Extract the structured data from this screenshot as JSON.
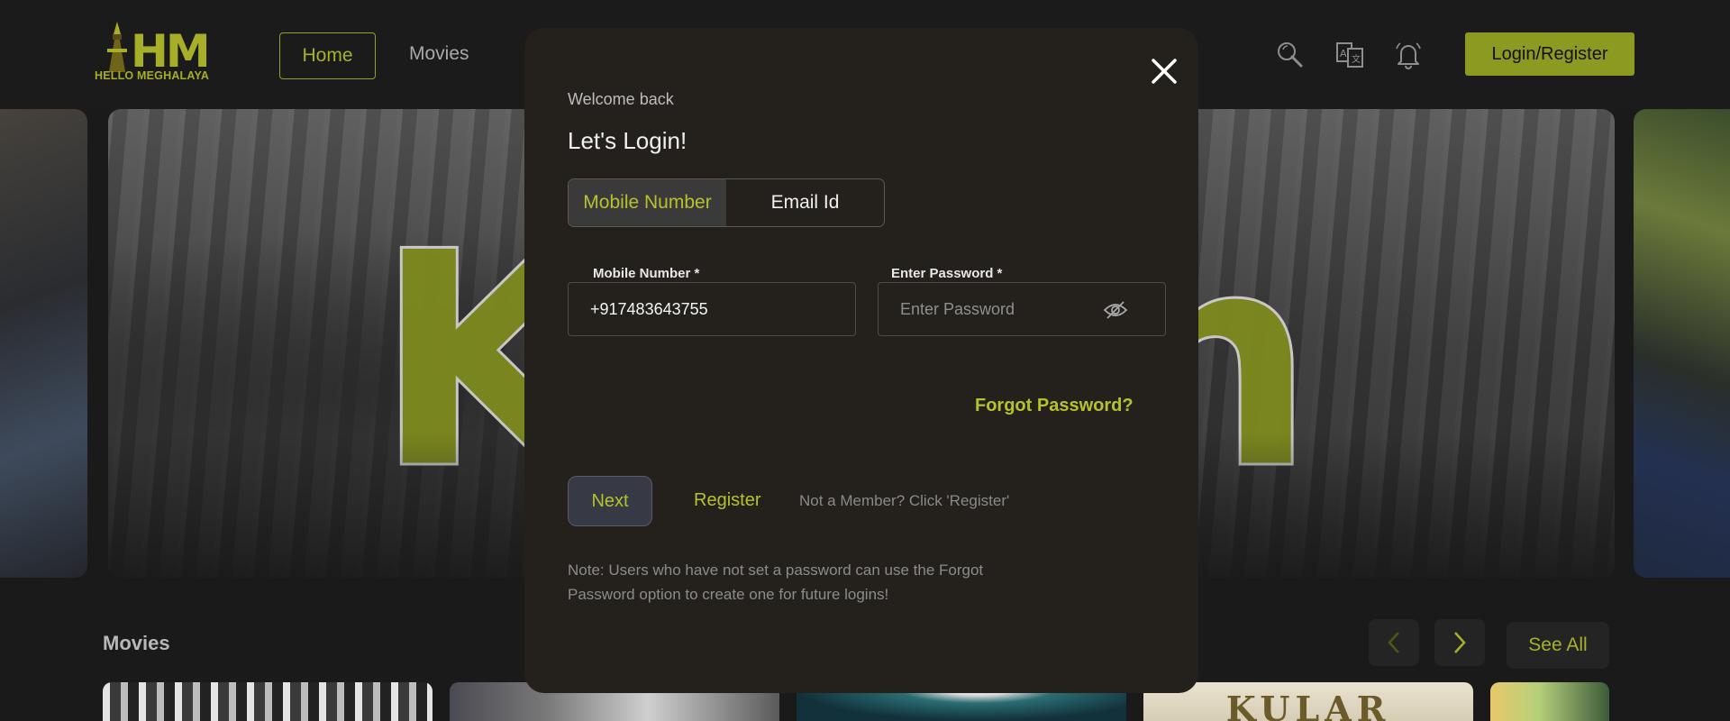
{
  "header": {
    "logo_text": "HELLO MEGHALAYA",
    "logo_mark": "HM",
    "nav": {
      "home": "Home",
      "movies": "Movies"
    },
    "icons": [
      "search-icon",
      "translate-icon",
      "bell-icon"
    ],
    "login_label": "Login/Register",
    "accent": "#8c9a22"
  },
  "hero": {
    "letters": [
      "K",
      "h"
    ]
  },
  "movies": {
    "title": "Movies",
    "see_all": "See All",
    "thumbs": [
      {
        "label": ""
      },
      {
        "label": ""
      },
      {
        "label": ""
      },
      {
        "label": "KULAR"
      },
      {
        "label": ""
      }
    ]
  },
  "modal": {
    "welcome": "Welcome back",
    "title": "Let's Login!",
    "tabs": {
      "mobile": "Mobile Number",
      "email": "Email Id"
    },
    "mobile_label": "Mobile Number *",
    "mobile_value": "+917483643755",
    "password_label": "Enter Password *",
    "password_placeholder": "Enter Password",
    "forgot": "Forgot Password?",
    "next": "Next",
    "register": "Register",
    "not_member": "Not a Member? Click 'Register'",
    "note": "Note: Users who have not set a password can use the Forgot Password option to create one for future logins!"
  }
}
